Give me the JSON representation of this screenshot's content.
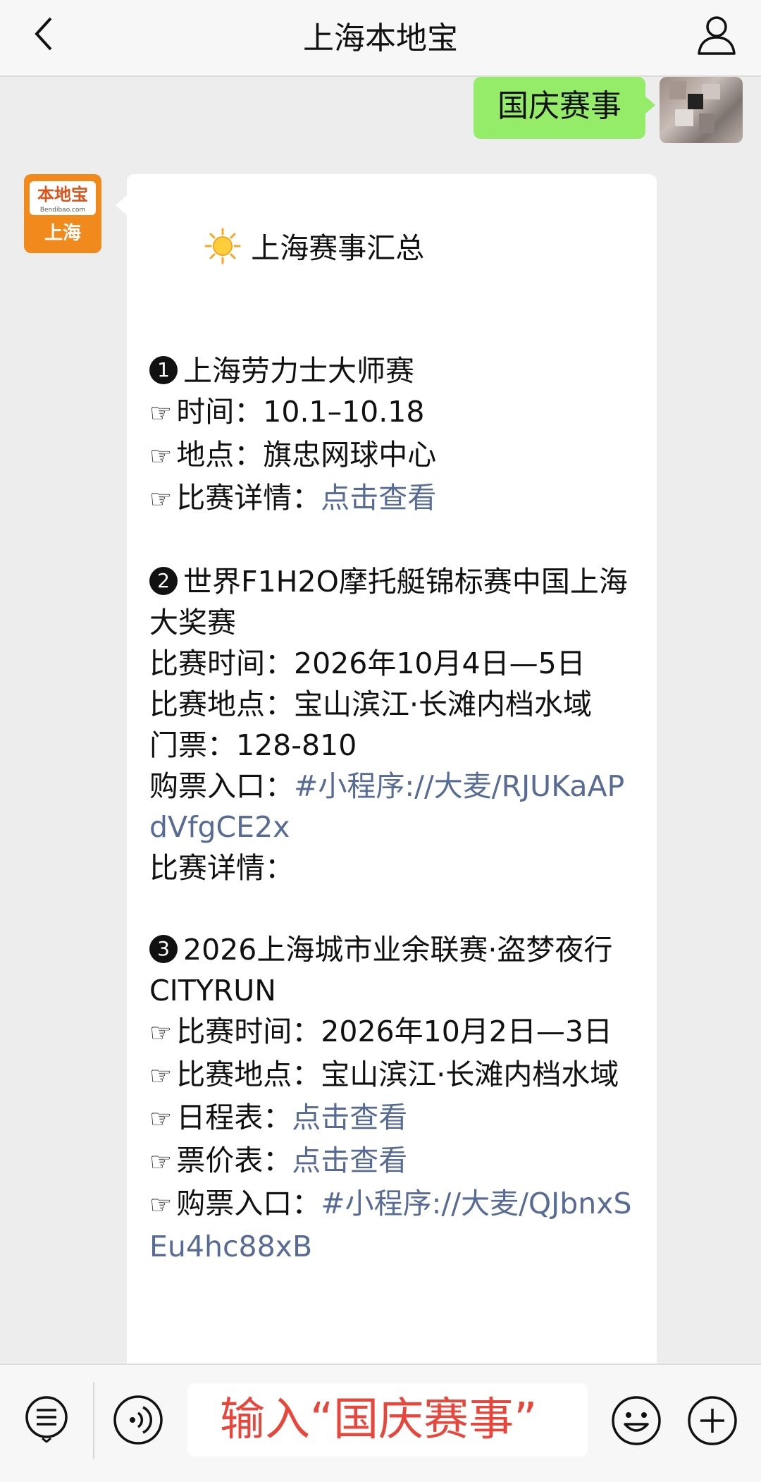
{
  "header": {
    "title": "上海本地宝"
  },
  "outgoing": {
    "text": "国庆赛事"
  },
  "bot_avatar": {
    "brand": "本地宝",
    "site": "Bendibao.com",
    "city": "上海"
  },
  "message": {
    "title": "上海赛事汇总",
    "e1_title": "上海劳力士大师赛",
    "e1_time": "时间：10.1–10.18",
    "e1_place": "地点：旗忠网球中心",
    "e1_detail_label": "比赛详情：",
    "e1_detail_link": "点击查看",
    "e2_title": "世界F1H2O摩托艇锦标赛中国上海大奖赛",
    "e2_time": "比赛时间：2026年10月4日—5日",
    "e2_place": "比赛地点：宝山滨江·长滩内档水域",
    "e2_ticket": "门票：128-810",
    "e2_buy_label": "购票入口：",
    "e2_buy_link": "#小程序://大麦/RJUKaAPdVfgCE2x",
    "e2_detail": "比赛详情：",
    "e3_title": "2026上海城市业余联赛·盗梦夜行 CITYRUN",
    "e3_time": "比赛时间：2026年10月2日—3日",
    "e3_place": "比赛地点：宝山滨江·长滩内档水域",
    "e3_schedule_label": "日程表：",
    "e3_schedule_link": "点击查看",
    "e3_price_label": "票价表：",
    "e3_price_link": "点击查看",
    "e3_buy_label": "购票入口：",
    "e3_buy_link": "#小程序://大麦/QJbnxSEu4hc88xB"
  },
  "icons": {
    "hand": "☞",
    "n1": "1",
    "n2": "2",
    "n3": "3"
  },
  "input": {
    "text": "输入“国庆赛事”"
  },
  "colors": {
    "link": "#576b95",
    "bubble_out": "#95ec69",
    "input_text": "#e8463b"
  }
}
